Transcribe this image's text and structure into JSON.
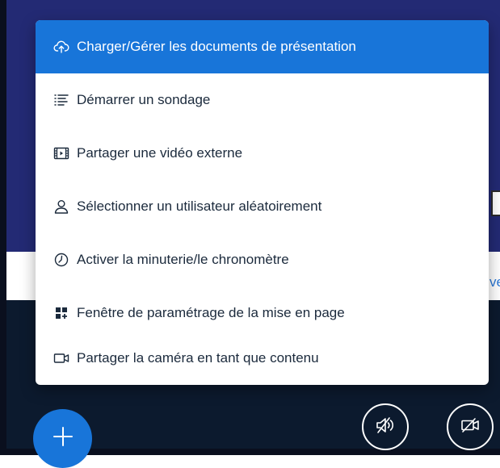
{
  "menu": {
    "items": [
      {
        "label": "Charger/Gérer les documents de présentation",
        "icon": "cloud-upload-icon",
        "active": true
      },
      {
        "label": "Démarrer un sondage",
        "icon": "poll-icon"
      },
      {
        "label": "Partager une vidéo externe",
        "icon": "video-icon"
      },
      {
        "label": "Sélectionner un utilisateur aléatoirement",
        "icon": "user-icon"
      },
      {
        "label": "Activer la minuterie/le chronomètre",
        "icon": "clock-icon"
      },
      {
        "label": "Fenêtre de paramétrage de la mise en page",
        "icon": "layout-icon"
      },
      {
        "label": "Partager la caméra en tant que contenu",
        "icon": "camera-icon"
      }
    ]
  },
  "background": {
    "partial_text": "ve"
  },
  "controls": {
    "actions_button_icon": "plus-icon",
    "audio_button_icon": "speaker-muted-icon",
    "video_button_icon": "camera-off-icon"
  },
  "colors": {
    "accent": "#1875d9",
    "header_bg": "#232a74",
    "bottom_bg": "#0c1a2e",
    "menu_text": "#1b2a3c"
  }
}
